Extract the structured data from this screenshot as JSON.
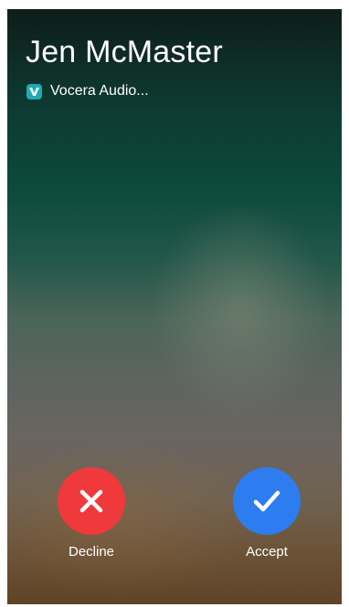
{
  "call": {
    "caller_name": "Jen McMaster",
    "app_name": "Vocera Audio..."
  },
  "actions": {
    "decline_label": "Decline",
    "accept_label": "Accept"
  },
  "colors": {
    "decline": "#f0393b",
    "accept": "#2d7df0",
    "app_icon": "#1fa9b6"
  },
  "icons": {
    "app": "vocera-app-icon",
    "decline": "close-icon",
    "accept": "checkmark-icon"
  }
}
